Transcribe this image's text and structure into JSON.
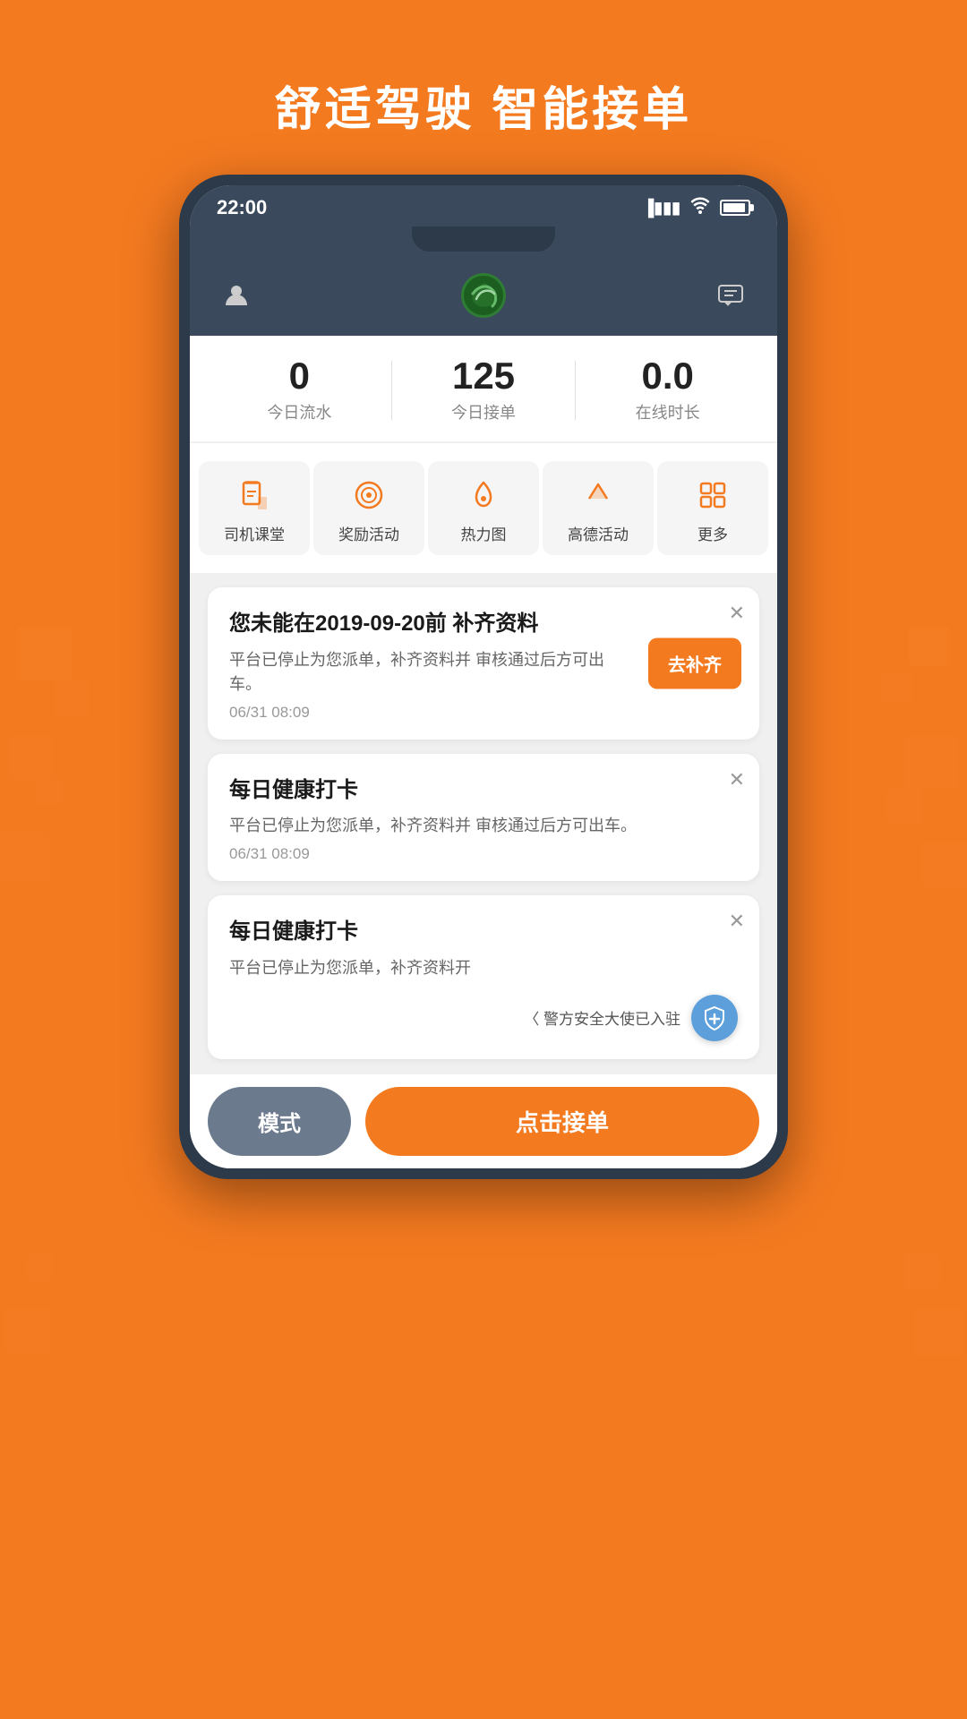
{
  "background": {
    "color": "#F47A20"
  },
  "header": {
    "tagline": "舒适驾驶  智能接单"
  },
  "statusBar": {
    "time": "22:00",
    "signal": "📶",
    "wifi": "WiFi",
    "battery": "battery"
  },
  "appHeader": {
    "profileIcon": "person",
    "messageIcon": "message"
  },
  "stats": [
    {
      "value": "0",
      "label": "今日流水"
    },
    {
      "value": "125",
      "label": "今日接单"
    },
    {
      "value": "0.0",
      "label": "在线时长"
    }
  ],
  "quickMenu": [
    {
      "id": "driver-class",
      "label": "司机课堂"
    },
    {
      "id": "reward",
      "label": "奖励活动"
    },
    {
      "id": "heatmap",
      "label": "热力图"
    },
    {
      "id": "gaode",
      "label": "高德活动"
    },
    {
      "id": "more",
      "label": "更多"
    }
  ],
  "cards": [
    {
      "id": "card1",
      "title": "您未能在2019-09-20前\n补齐资料",
      "body": "平台已停止为您派单，补齐资料并\n审核通过后方可出车。",
      "time": "06/31 08:09",
      "actionLabel": "去补齐",
      "hasAction": true
    },
    {
      "id": "card2",
      "title": "每日健康打卡",
      "body": "平台已停止为您派单，补齐资料并\n审核通过后方可出车。",
      "time": "06/31 08:09",
      "hasAction": false
    },
    {
      "id": "card3",
      "title": "每日健康打卡",
      "body": "平台已停止为您派单，补齐资料开",
      "time": "",
      "hasAction": false,
      "partial": true
    }
  ],
  "securityBanner": {
    "text": "〈 警方安全大使已入驻"
  },
  "bottomBar": {
    "modeLabel": "模式",
    "acceptLabel": "点击接单"
  }
}
